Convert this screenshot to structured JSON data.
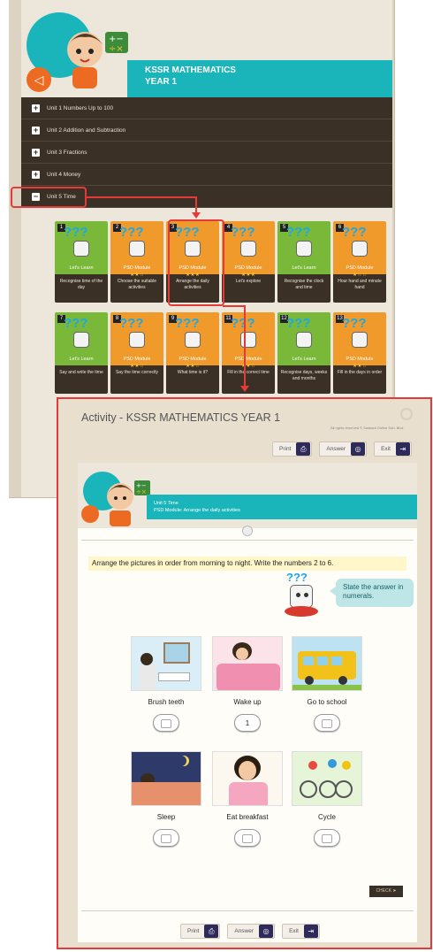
{
  "back_screen": {
    "title_line1": "KSSR MATHEMATICS",
    "title_line2": "YEAR 1",
    "units": [
      {
        "label": "Unit 1 Numbers Up to 100",
        "sign": "+"
      },
      {
        "label": "Unit 2 Addition and Subtraction",
        "sign": "+"
      },
      {
        "label": "Unit 3 Fractions",
        "sign": "+"
      },
      {
        "label": "Unit 4 Money",
        "sign": "+"
      },
      {
        "label": "Unit 5 Time",
        "sign": "−"
      }
    ],
    "cards": [
      {
        "num": "1",
        "kind": "Let's Learn",
        "caption": "Recognise time of the day",
        "color": "green",
        "stars": ""
      },
      {
        "num": "2",
        "kind": "PSD Module",
        "caption": "Choose the suitable activities",
        "color": "orange",
        "stars": "★★☆"
      },
      {
        "num": "3",
        "kind": "PSD Module",
        "caption": "Arrange the daily activities",
        "color": "orange",
        "stars": "★★★"
      },
      {
        "num": "4",
        "kind": "PSD Module",
        "caption": "Let's explore",
        "color": "orange",
        "stars": "★★★"
      },
      {
        "num": "5",
        "kind": "Let's Learn",
        "caption": "Recognise the clock and time",
        "color": "green",
        "stars": ""
      },
      {
        "num": "6",
        "kind": "PSD Module",
        "caption": "Hour hand and minute hand",
        "color": "orange",
        "stars": "★☆☆"
      },
      {
        "num": "7",
        "kind": "Let's Learn",
        "caption": "Say and write the time",
        "color": "green",
        "stars": ""
      },
      {
        "num": "8",
        "kind": "PSD Module",
        "caption": "Say the time correctly",
        "color": "orange",
        "stars": "★★☆"
      },
      {
        "num": "9",
        "kind": "PSD Module",
        "caption": "What time is it?",
        "color": "orange",
        "stars": "★★☆"
      },
      {
        "num": "11",
        "kind": "PSD Module",
        "caption": "Fill in the correct time",
        "color": "orange",
        "stars": "★★☆"
      },
      {
        "num": "12",
        "kind": "Let's Learn",
        "caption": "Recognise days, weeks and months",
        "color": "green",
        "stars": ""
      },
      {
        "num": "13",
        "kind": "PSD Module",
        "caption": "Fill in the days in order",
        "color": "orange",
        "stars": "★★☆"
      }
    ]
  },
  "activity": {
    "title": "Activity - KSSR MATHEMATICS YEAR 1",
    "rights": "All rights reserved © Sasbadi Online Sdn. Bhd.",
    "toolbar": {
      "print": "Print",
      "answer": "Answer",
      "exit": "Exit"
    },
    "unit": "Unit 5 Time",
    "module": "PSD Module: Arrange the daily activities",
    "instruction": "Arrange the pictures in order from morning to night. Write the numbers 2 to 6.",
    "speech": "State the answer in numerals.",
    "mascot_text": "???",
    "items": [
      {
        "label": "Brush teeth",
        "answer": ""
      },
      {
        "label": "Wake up",
        "answer": "1"
      },
      {
        "label": "Go to school",
        "answer": ""
      },
      {
        "label": "Sleep",
        "answer": ""
      },
      {
        "label": "Eat breakfast",
        "answer": ""
      },
      {
        "label": "Cycle",
        "answer": ""
      }
    ],
    "check_label": "CHECK",
    "bottom_toolbar": {
      "print": "Print",
      "answer": "Answer",
      "exit": "Exit"
    }
  },
  "colors": {
    "accent": "#19b5ba",
    "dark": "#3a3026",
    "highlight": "#e53a3a"
  }
}
